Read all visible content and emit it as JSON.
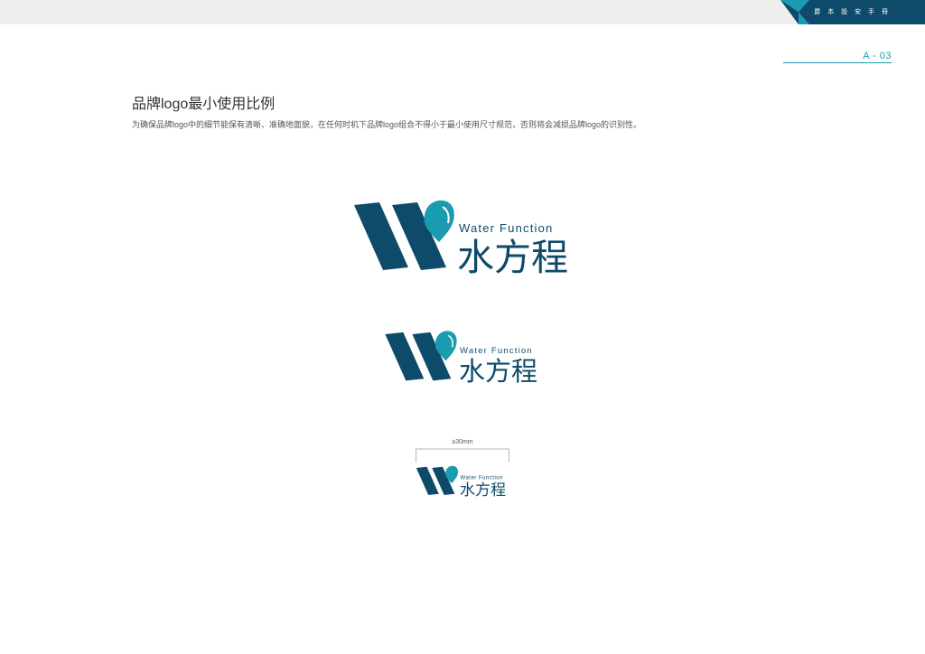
{
  "header": {
    "corner_text": "爵 本 設 安 手 冊",
    "page_number": "A - 03",
    "accent_color": "#1a9bb0",
    "dark_color": "#0e4a6a"
  },
  "section": {
    "title": "品牌logo最小使用比例",
    "description": "为确保品牌logo中的细节能保有清晰、准确地面貌，在任何时机下品牌logo组合不得小于最小使用尺寸规范，否则将会减损品牌logo的识别性。"
  },
  "logo": {
    "english_name": "Water Function",
    "chinese_name": "水方程",
    "mark_icon": "water-drop-w-icon"
  },
  "minimum_size": {
    "label": "≥30mm"
  }
}
